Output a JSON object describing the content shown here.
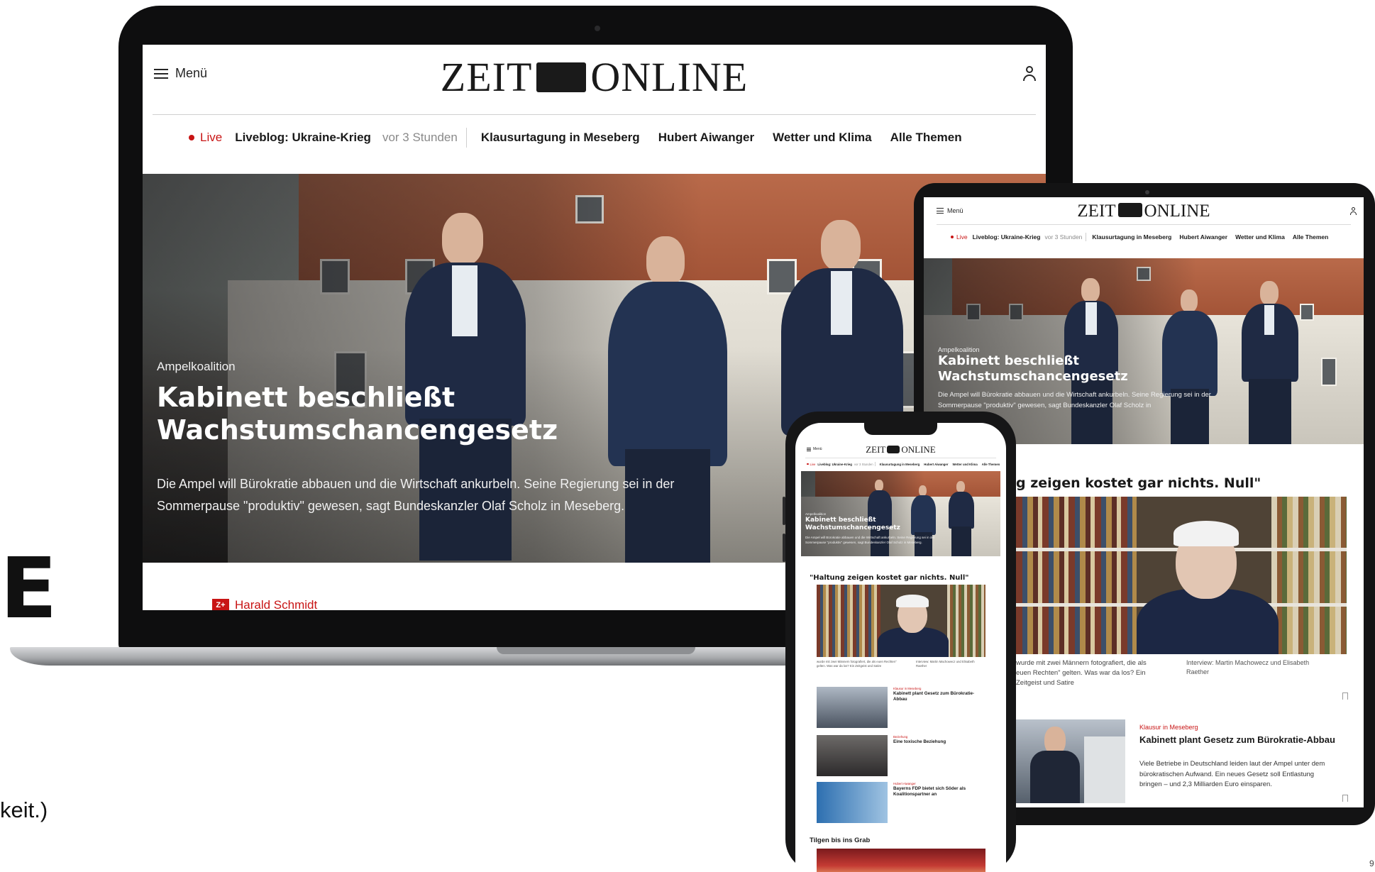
{
  "slide": {
    "title_fragment": "E",
    "body_fragment": "keit.)",
    "page_number": "9"
  },
  "site": {
    "logo_left": "ZEIT",
    "logo_right": "ONLINE",
    "menu_label": "Menü",
    "live_label": "Live",
    "nav": {
      "liveblog": "Liveblog: Ukraine-Krieg",
      "liveblog_time": "vor 3 Stunden",
      "items": [
        "Klausurtagung in Meseberg",
        "Hubert Aiwanger",
        "Wetter und Klima",
        "Alle Themen"
      ]
    }
  },
  "hero": {
    "kicker": "Ampelkoalition",
    "title": "Kabinett beschließt Wachstumschancengesetz",
    "teaser": "Die Ampel will Bürokratie abbauen und die Wirtschaft ankurbeln. Seine Regierung sei in der Sommerpause \"produktiv\" gewesen, sagt Bundeskanzler Olaf Scholz in Meseberg.",
    "tablet_teaser": "Die Ampel will Bürokratie abbauen und die Wirtschaft ankurbeln. Seine Regierung sei in der Sommerpause \"produktiv\" gewesen, sagt Bundeskanzler Olaf Scholz in"
  },
  "zplus": {
    "badge": "Z+",
    "author": "Harald Schmidt"
  },
  "interview": {
    "tablet_quote": "g zeigen kostet gar nichts. Null\"",
    "phone_quote": "\"Haltung zeigen kostet gar nichts. Null\"",
    "caption": "wurde mit zwei Männern fotografiert, die als euen Rechten\" gelten. Was war da los? Ein Zeitgeist und Satire",
    "credit": "Interview: Martin Machowecz und Elisabeth Raether"
  },
  "article2": {
    "kicker": "Klausur in Meseberg",
    "title": "Kabinett plant Gesetz zum Bürokratie-Abbau",
    "teaser": "Viele Betriebe in Deutschland leiden laut der Ampel unter dem bürokratischen Aufwand. Ein neues Gesetz soll Entlastung bringen – und 2,3 Milliarden Euro einsparen."
  },
  "phone": {
    "items": [
      {
        "kicker": "Klausur in Meseberg",
        "title": "Kabinett plant Gesetz zum Bürokratie-Abbau"
      },
      {
        "kicker": "Beziehung",
        "title": "Eine toxische Beziehung"
      },
      {
        "kicker": "Hubert Aiwanger",
        "title": "Bayerns FDP bietet sich Söder als Koalitionspartner an"
      }
    ],
    "last_title": "Tilgen bis ins Grab"
  }
}
